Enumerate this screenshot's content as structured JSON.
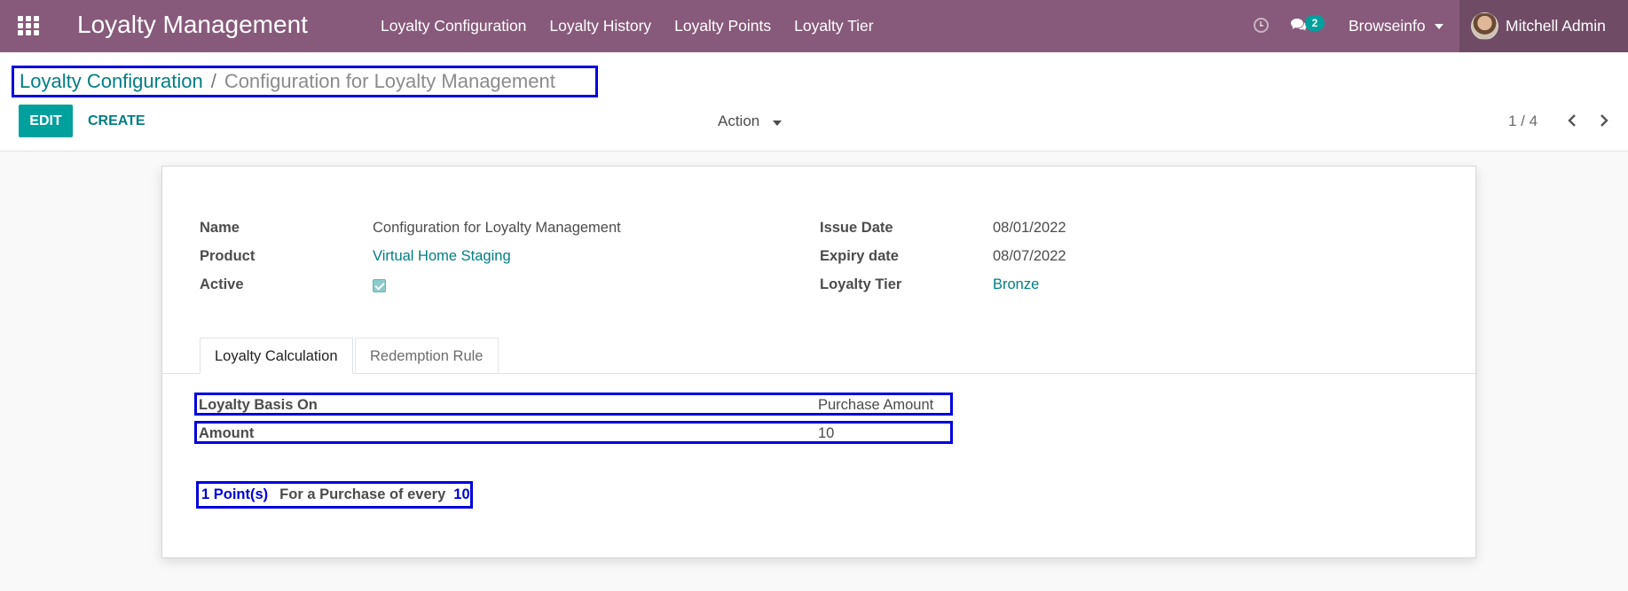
{
  "navbar": {
    "brand": "Loyalty Management",
    "menu": [
      "Loyalty Configuration",
      "Loyalty History",
      "Loyalty Points",
      "Loyalty Tier"
    ],
    "chat_count": "2",
    "company": "Browseinfo",
    "user": "Mitchell Admin",
    "color": "#875a7b"
  },
  "control_panel": {
    "breadcrumb_parent": "Loyalty Configuration",
    "breadcrumb_separator": "/",
    "breadcrumb_current": "Configuration for Loyalty Management",
    "edit_label": "EDIT",
    "create_label": "CREATE",
    "action_label": "Action",
    "pager": "1 / 4"
  },
  "form": {
    "name_label": "Name",
    "name_value": "Configuration for Loyalty Management",
    "product_label": "Product",
    "product_value": "Virtual Home Staging",
    "active_label": "Active",
    "issue_date_label": "Issue Date",
    "issue_date_value": "08/01/2022",
    "expiry_label": "Expiry date",
    "expiry_value": "08/07/2022",
    "tier_label": "Loyalty Tier",
    "tier_value": "Bronze"
  },
  "tabs": [
    "Loyalty Calculation",
    "Redemption Rule"
  ],
  "calculation": {
    "basis_label": "Loyalty Basis On",
    "basis_value": "Purchase Amount",
    "amount_label": "Amount",
    "amount_value": "10",
    "points": "1 Point(s)",
    "points_text": "For a Purchase of every",
    "points_amount": "10"
  }
}
